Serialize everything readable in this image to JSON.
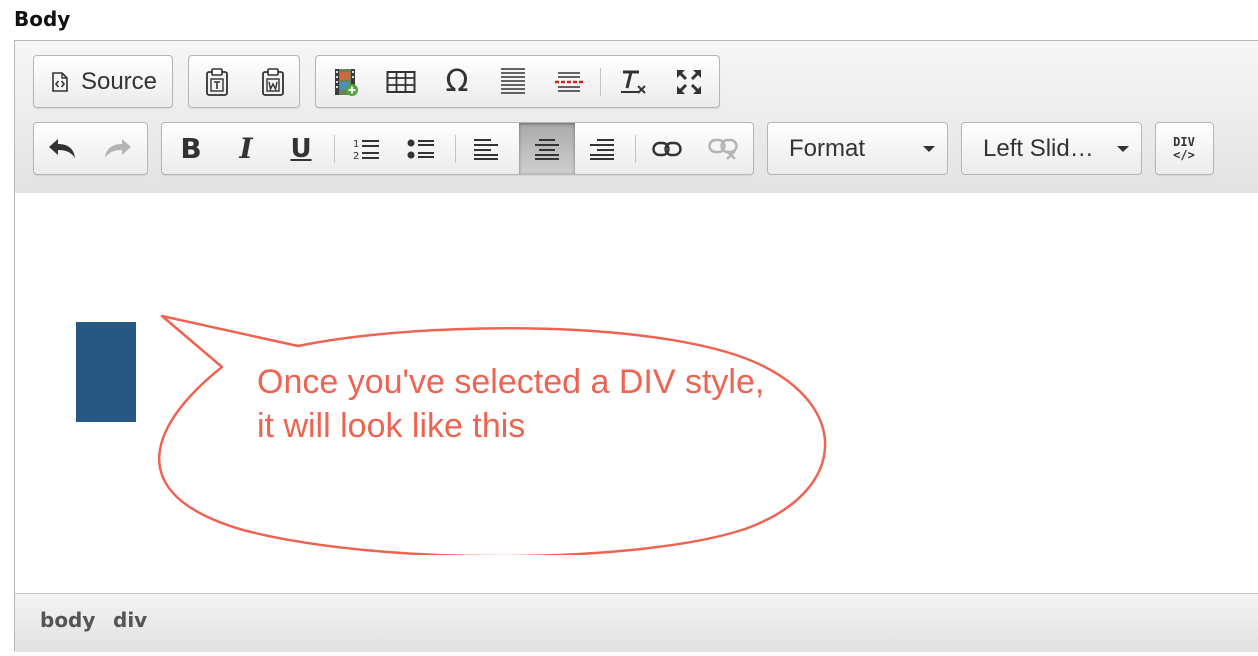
{
  "field": {
    "label": "Body"
  },
  "toolbar": {
    "source_label": "Source",
    "format_label": "Format",
    "styles_label": "Left Slid…",
    "div_label_top": "DIV",
    "div_label_bottom": "</>"
  },
  "content": {
    "callout_text": "Once you've selected a DIV style, it will look like this"
  },
  "statusbar": {
    "path": [
      "body",
      "div"
    ]
  },
  "colors": {
    "div_block": "#265782",
    "callout": "#ee6352",
    "active_button": "#a9a9a9"
  },
  "icons": {
    "row1": [
      "source-icon",
      "paste-as-text-icon",
      "paste-from-word-icon",
      "media-icon",
      "table-icon",
      "special-char-omega-icon",
      "horizontal-line-icon",
      "page-break-icon",
      "remove-format-icon",
      "maximize-icon"
    ],
    "row2": [
      "undo-icon",
      "redo-icon",
      "bold-icon",
      "italic-icon",
      "underline-icon",
      "numbered-list-icon",
      "bulleted-list-icon",
      "align-left-icon",
      "align-center-icon",
      "align-right-icon",
      "link-icon",
      "unlink-icon",
      "create-div-icon"
    ]
  },
  "state": {
    "active_button": "align-center"
  }
}
